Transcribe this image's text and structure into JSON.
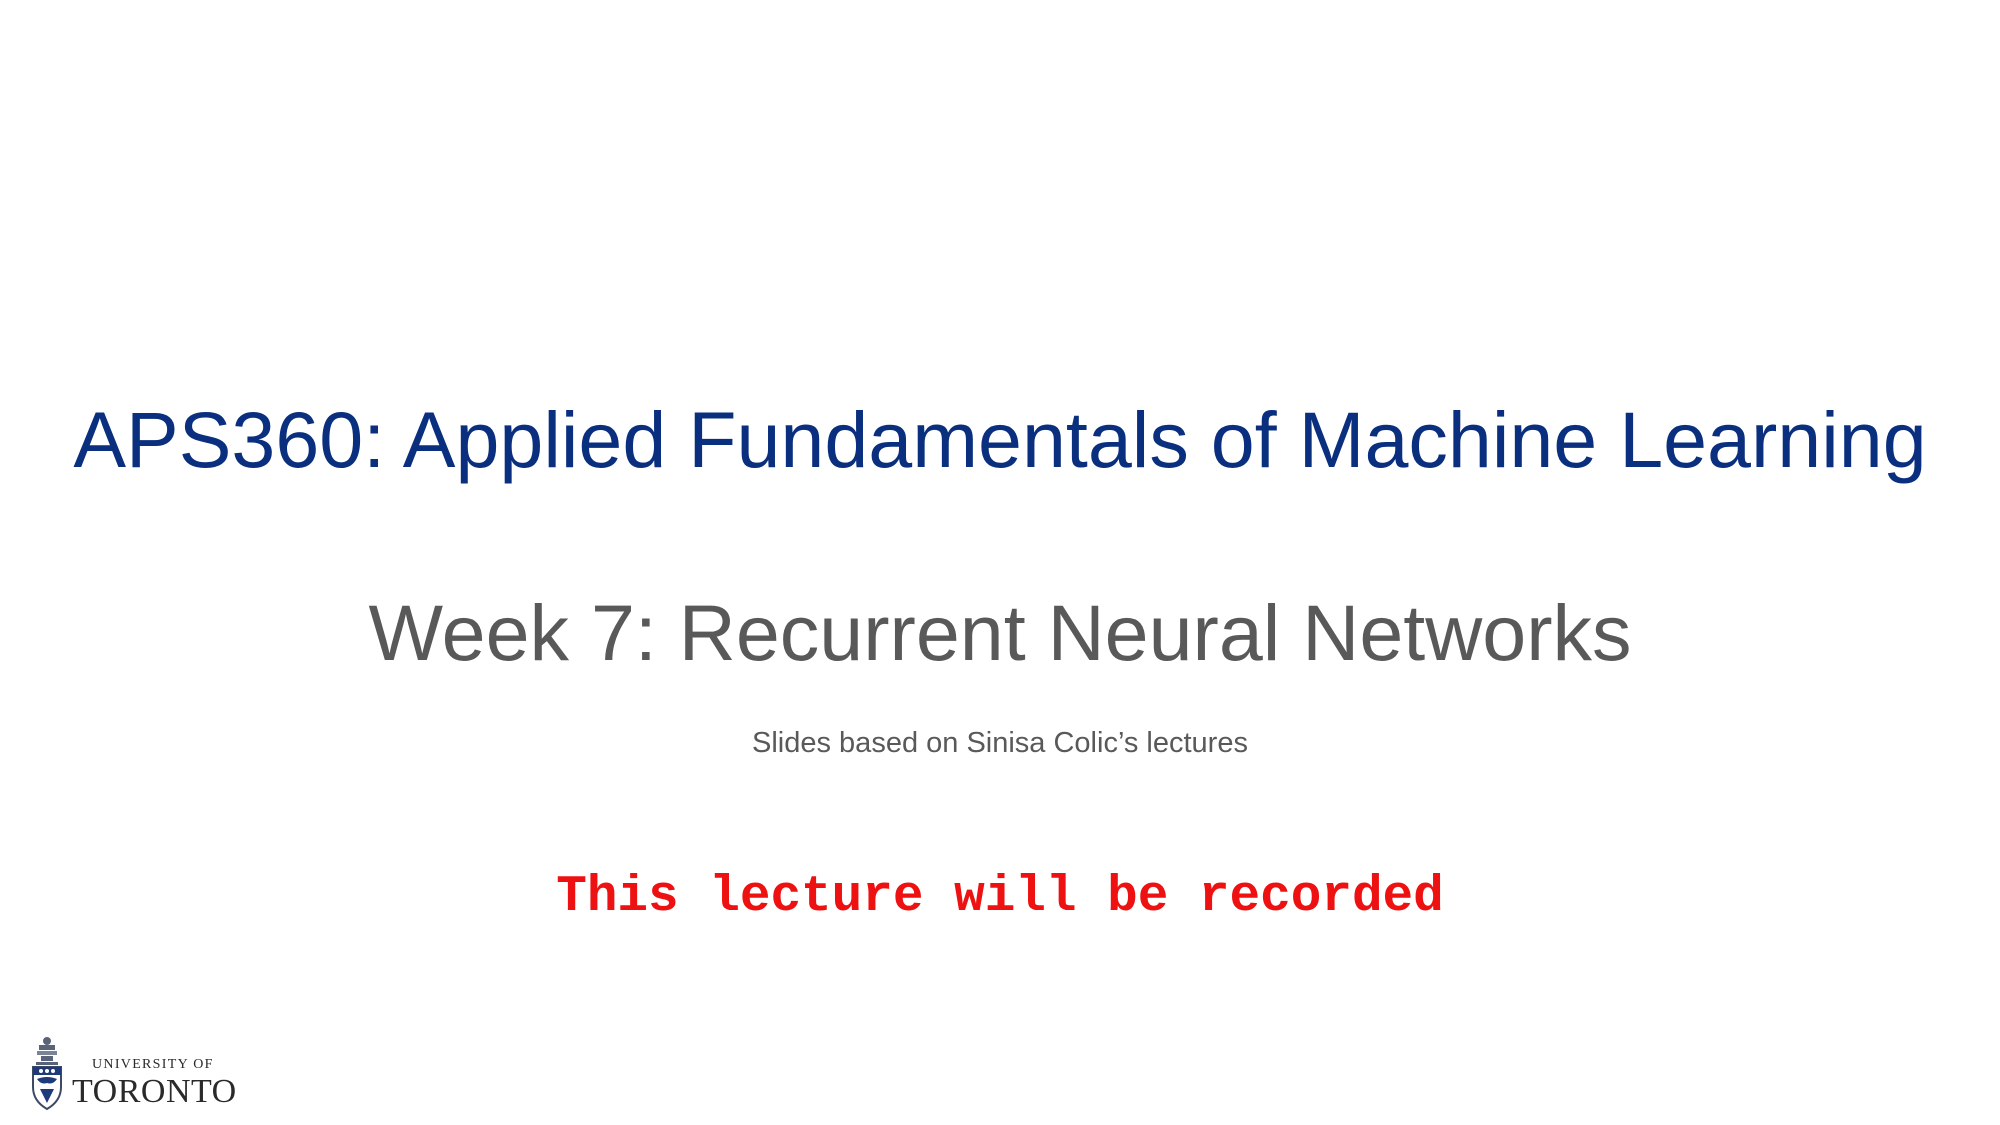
{
  "slide": {
    "course_title": "APS360: Applied Fundamentals of Machine Learning",
    "week_title": "Week 7: Recurrent Neural Networks",
    "credits": "Slides based on Sinisa Colic’s lectures",
    "recording_notice": "This lecture will be recorded"
  },
  "logo": {
    "line1": "UNIVERSITY OF",
    "line2": "TORONTO",
    "crest_icon": "university-crest-icon"
  },
  "colors": {
    "title_blue": "#0a2f7f",
    "subtitle_gray": "#595959",
    "notice_red": "#ee1111",
    "background": "#ffffff"
  }
}
